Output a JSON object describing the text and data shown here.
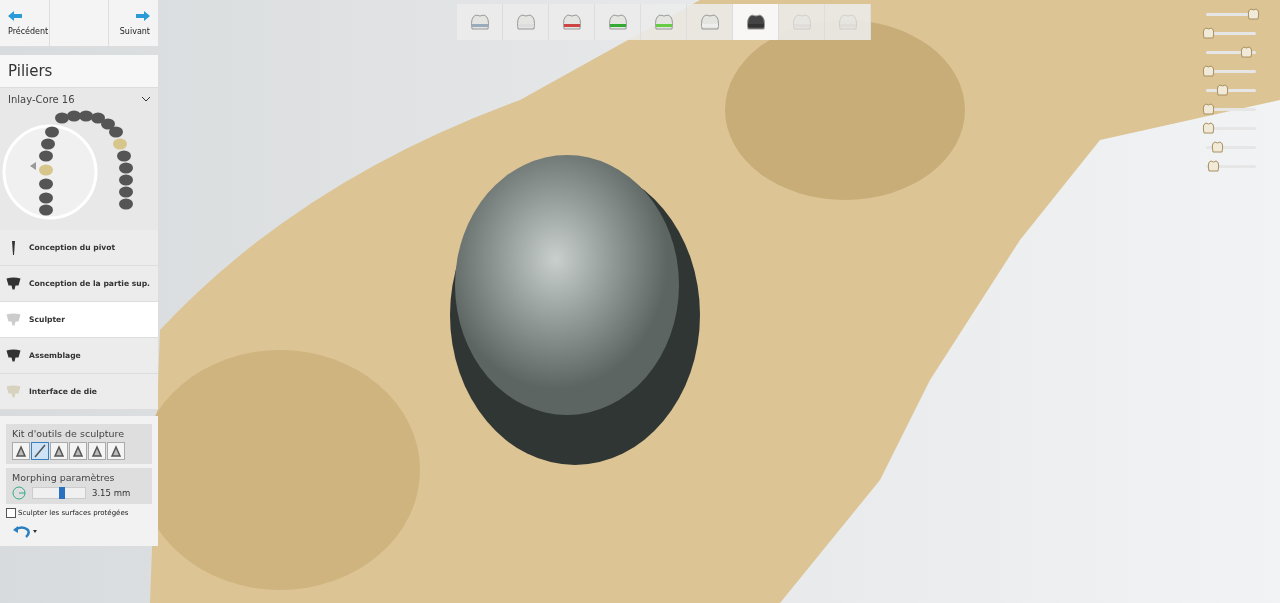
{
  "navigation": {
    "previous": "Précédent",
    "next": "Suivant"
  },
  "panel": {
    "title": "Piliers",
    "dropdown": "Inlay-Core 16",
    "steps": [
      {
        "label": "Conception du pivot",
        "selected": false
      },
      {
        "label": "Conception de la partie sup.",
        "selected": false
      },
      {
        "label": "Sculpter",
        "selected": true
      },
      {
        "label": "Assemblage",
        "selected": false
      },
      {
        "label": "Interface de die",
        "selected": false
      }
    ],
    "toolkit": {
      "title": "Kit d'outils de sculpture",
      "tools": [
        {
          "selected": false
        },
        {
          "selected": true
        },
        {
          "selected": false
        },
        {
          "selected": false
        },
        {
          "selected": false
        },
        {
          "selected": false
        }
      ]
    },
    "morphing": {
      "title": "Morphing paramètres",
      "level": 0.55,
      "reading": "3.15 mm"
    },
    "protect_checkbox": {
      "label": "Sculpter les surfaces protégées",
      "checked": false
    }
  },
  "toolbar": [
    {
      "selected": false,
      "disabled": false
    },
    {
      "selected": false,
      "disabled": false
    },
    {
      "selected": false,
      "disabled": false
    },
    {
      "selected": false,
      "disabled": false
    },
    {
      "selected": false,
      "disabled": false
    },
    {
      "selected": false,
      "disabled": false
    },
    {
      "selected": true,
      "disabled": false
    },
    {
      "selected": false,
      "disabled": true
    },
    {
      "selected": false,
      "disabled": true
    }
  ],
  "visibility_sliders": [
    {
      "level": 1
    },
    {
      "level": 0
    },
    {
      "level": 0.85
    },
    {
      "level": 0
    },
    {
      "level": 0.3
    },
    {
      "level": 0
    },
    {
      "level": 0
    },
    {
      "level": 0.2
    },
    {
      "level": 0.1
    }
  ]
}
